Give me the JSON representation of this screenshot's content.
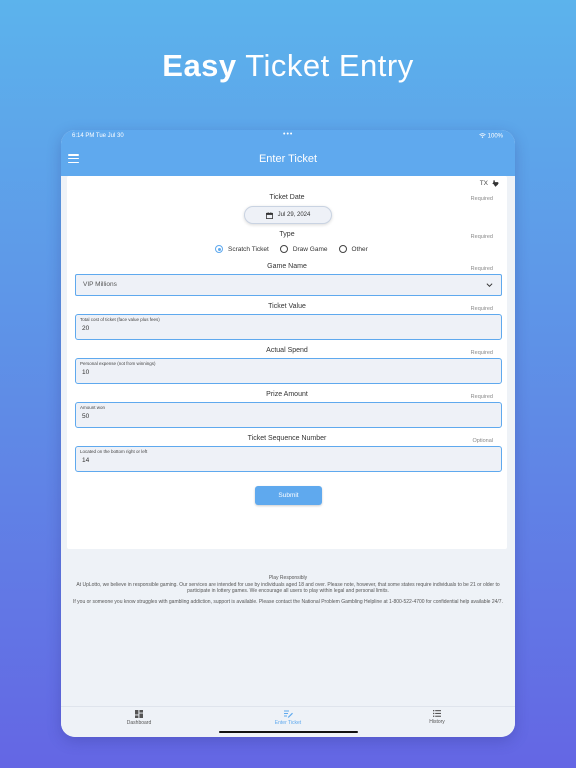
{
  "promo": {
    "title_bold": "Easy",
    "title_rest": "Ticket Entry"
  },
  "status_bar": {
    "time": "6:14 PM  Tue Jul 30",
    "dots": "•••",
    "battery": "100%"
  },
  "nav": {
    "title": "Enter Ticket"
  },
  "state": {
    "code": "TX"
  },
  "form": {
    "ticket_date": {
      "label": "Ticket Date",
      "required": "Required",
      "value": "Jul 29, 2024"
    },
    "type": {
      "label": "Type",
      "required": "Required",
      "options": [
        "Scratch Ticket",
        "Draw Game",
        "Other"
      ],
      "selected": "Scratch Ticket"
    },
    "game_name": {
      "label": "Game Name",
      "required": "Required",
      "value": "VIP Millions"
    },
    "ticket_value": {
      "label": "Ticket Value",
      "required": "Required",
      "hint": "Total cost of ticket (face value plus fees)",
      "value": "20"
    },
    "actual_spend": {
      "label": "Actual Spend",
      "required": "Required",
      "hint": "Personal expense (not from winnings)",
      "value": "10"
    },
    "prize_amount": {
      "label": "Prize Amount",
      "required": "Required",
      "hint": "Amount won",
      "value": "50"
    },
    "sequence": {
      "label": "Ticket Sequence Number",
      "required": "Optional",
      "hint": "Located on the bottom right or left",
      "value": "14"
    },
    "submit_label": "Submit"
  },
  "footer": {
    "heading": "Play Responsibly",
    "para1": "At UpLotto, we believe in responsible gaming. Our services are intended for use by individuals aged 18 and over. Please note, however, that some states require individuals to be 21 or older to participate in lottery games. We encourage all users to play within legal and personal limits.",
    "para2": "If you or someone you know struggles with gambling addiction, support is available. Please contact the National Problem Gambling Helpline at 1-800-522-4700 for confidential help available 24/7."
  },
  "tabs": {
    "dashboard": "Dashboard",
    "enter_ticket": "Enter Ticket",
    "history": "History"
  },
  "colors": {
    "accent": "#5fa9ee",
    "background_top": "#5cb3ec",
    "background_bottom": "#6466e4"
  }
}
